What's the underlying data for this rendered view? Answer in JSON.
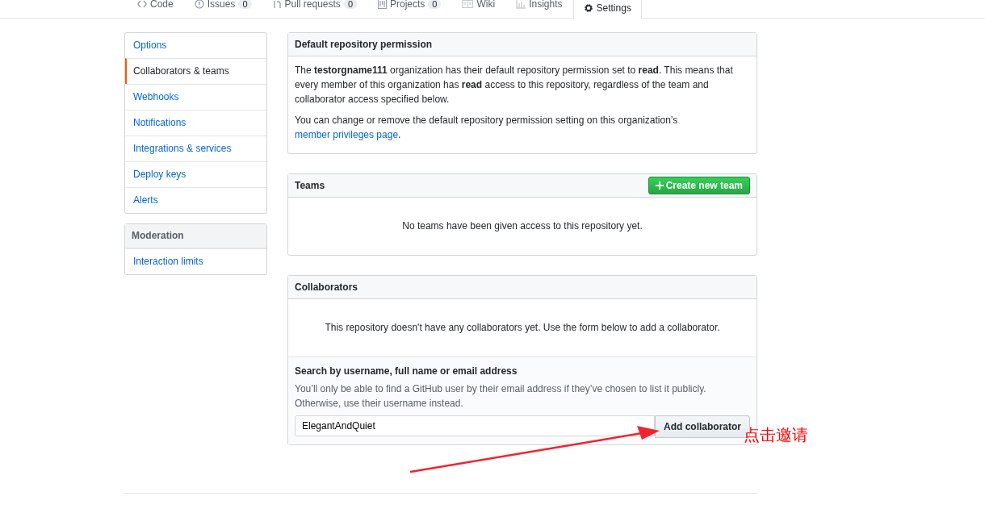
{
  "tabs": [
    {
      "kind": "code",
      "label": "Code",
      "selected": false
    },
    {
      "kind": "issue",
      "label": "Issues",
      "count": "0",
      "selected": false
    },
    {
      "kind": "pr",
      "label": "Pull requests",
      "count": "0",
      "selected": false
    },
    {
      "kind": "project",
      "label": "Projects",
      "count": "0",
      "selected": false
    },
    {
      "kind": "wiki",
      "label": "Wiki",
      "selected": false
    },
    {
      "kind": "graph",
      "label": "Insights",
      "selected": false
    },
    {
      "kind": "gear",
      "label": "Settings",
      "selected": true
    }
  ],
  "sidebar": {
    "items": [
      {
        "label": "Options",
        "selected": false
      },
      {
        "label": "Collaborators & teams",
        "selected": true
      },
      {
        "label": "Webhooks",
        "selected": false
      },
      {
        "label": "Notifications",
        "selected": false
      },
      {
        "label": "Integrations & services",
        "selected": false
      },
      {
        "label": "Deploy keys",
        "selected": false
      },
      {
        "label": "Alerts",
        "selected": false
      }
    ],
    "moderation": {
      "title": "Moderation",
      "items": [
        {
          "label": "Interaction limits",
          "selected": false
        }
      ]
    }
  },
  "default_permission": {
    "title": "Default repository permission",
    "text": "The **testorgname111** organization has their default repository permission set to **read**. This means that every member of this organization has **read** access to this repository, regardless of the team and collaborator access specified below.",
    "note": "You can change or remove the default repository permission setting on this organization’s ",
    "link": "member privileges page",
    "note_end": "."
  },
  "teams": {
    "title": "Teams",
    "button": "Create new team",
    "empty": "No teams have been given access to this repository yet."
  },
  "collaborators": {
    "title": "Collaborators",
    "empty": "This repository doesn't have any collaborators yet. Use the form below to add a collaborator.",
    "search_label": "Search by username, full name or email address",
    "hint": "You’ll only be able to find a GitHub user by their email address if they’ve chosen to list it publicly. Otherwise, use their username instead.",
    "value": "ElegantAndQuiet",
    "button": "Add collaborator"
  },
  "annotation": "点击邀请"
}
